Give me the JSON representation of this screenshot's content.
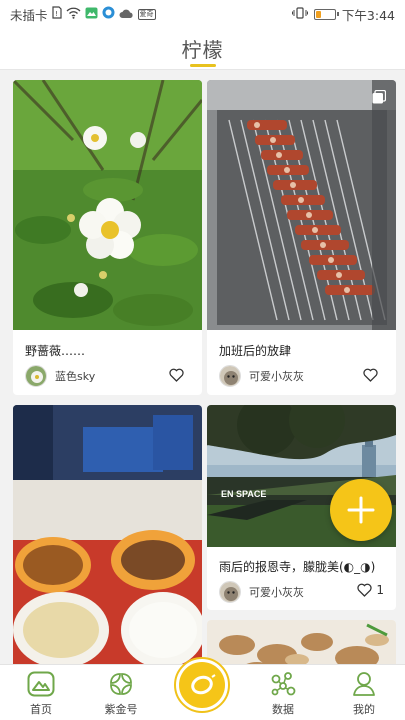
{
  "status_bar": {
    "carrier": "未插卡",
    "time": "下午3:44",
    "battery_percent": 30,
    "app_badge": "爱奇"
  },
  "header": {
    "title": "柠檬"
  },
  "cards": [
    {
      "caption": "野蔷薇……",
      "author": "蓝色sky",
      "likes": ""
    },
    {
      "caption": "加班后的放肆",
      "author": "可爱小灰灰",
      "likes": ""
    },
    {
      "caption": "",
      "author": "",
      "likes": ""
    },
    {
      "caption": "雨后的报恩寺，朦胧美(◐_◑)",
      "author": "可爱小灰灰",
      "likes": "1",
      "photo_text": "EN SPACE"
    }
  ],
  "bottom_nav": {
    "items": [
      {
        "label": "首页",
        "icon": "mountain-icon"
      },
      {
        "label": "紫金号",
        "icon": "leaf-grid-icon"
      },
      {
        "label": "",
        "icon": "lemon-icon"
      },
      {
        "label": "数据",
        "icon": "molecule-icon"
      },
      {
        "label": "我的",
        "icon": "person-icon"
      }
    ]
  },
  "colors": {
    "accent": "#f5c518",
    "nav_green": "#6fa74a"
  }
}
